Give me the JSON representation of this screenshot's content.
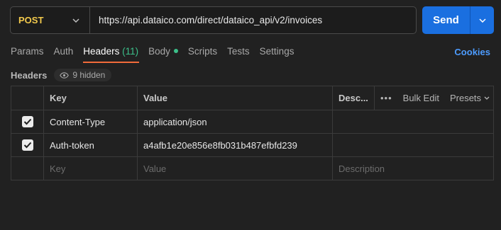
{
  "request": {
    "method": "POST",
    "url": "https://api.dataico.com/direct/dataico_api/v2/invoices",
    "send_label": "Send"
  },
  "tabs": [
    {
      "label": "Params"
    },
    {
      "label": "Auth"
    },
    {
      "label": "Headers",
      "count": "(11)",
      "active": true
    },
    {
      "label": "Body",
      "indicator": "green-dot"
    },
    {
      "label": "Scripts"
    },
    {
      "label": "Tests"
    },
    {
      "label": "Settings"
    }
  ],
  "cookies_label": "Cookies",
  "headers_section": {
    "title": "Headers",
    "hidden_label": "9 hidden",
    "columns": {
      "key": "Key",
      "value": "Value",
      "description": "Desc..."
    },
    "actions": {
      "more": "•••",
      "bulk_edit": "Bulk Edit",
      "presets": "Presets"
    },
    "rows": [
      {
        "checked": true,
        "key": "Content-Type",
        "value": "application/json",
        "description": ""
      },
      {
        "checked": true,
        "key": "Auth-token",
        "value": "a4afb1e20e856e8fb031b487efbfd239",
        "description": ""
      }
    ],
    "placeholders": {
      "key": "Key",
      "value": "Value",
      "description": "Description"
    }
  },
  "colors": {
    "accent": "#1a6fe0",
    "method": "#f2c94c",
    "active_tab_underline": "#f26b3a",
    "count": "#3cc08a",
    "link": "#4d9cff"
  }
}
